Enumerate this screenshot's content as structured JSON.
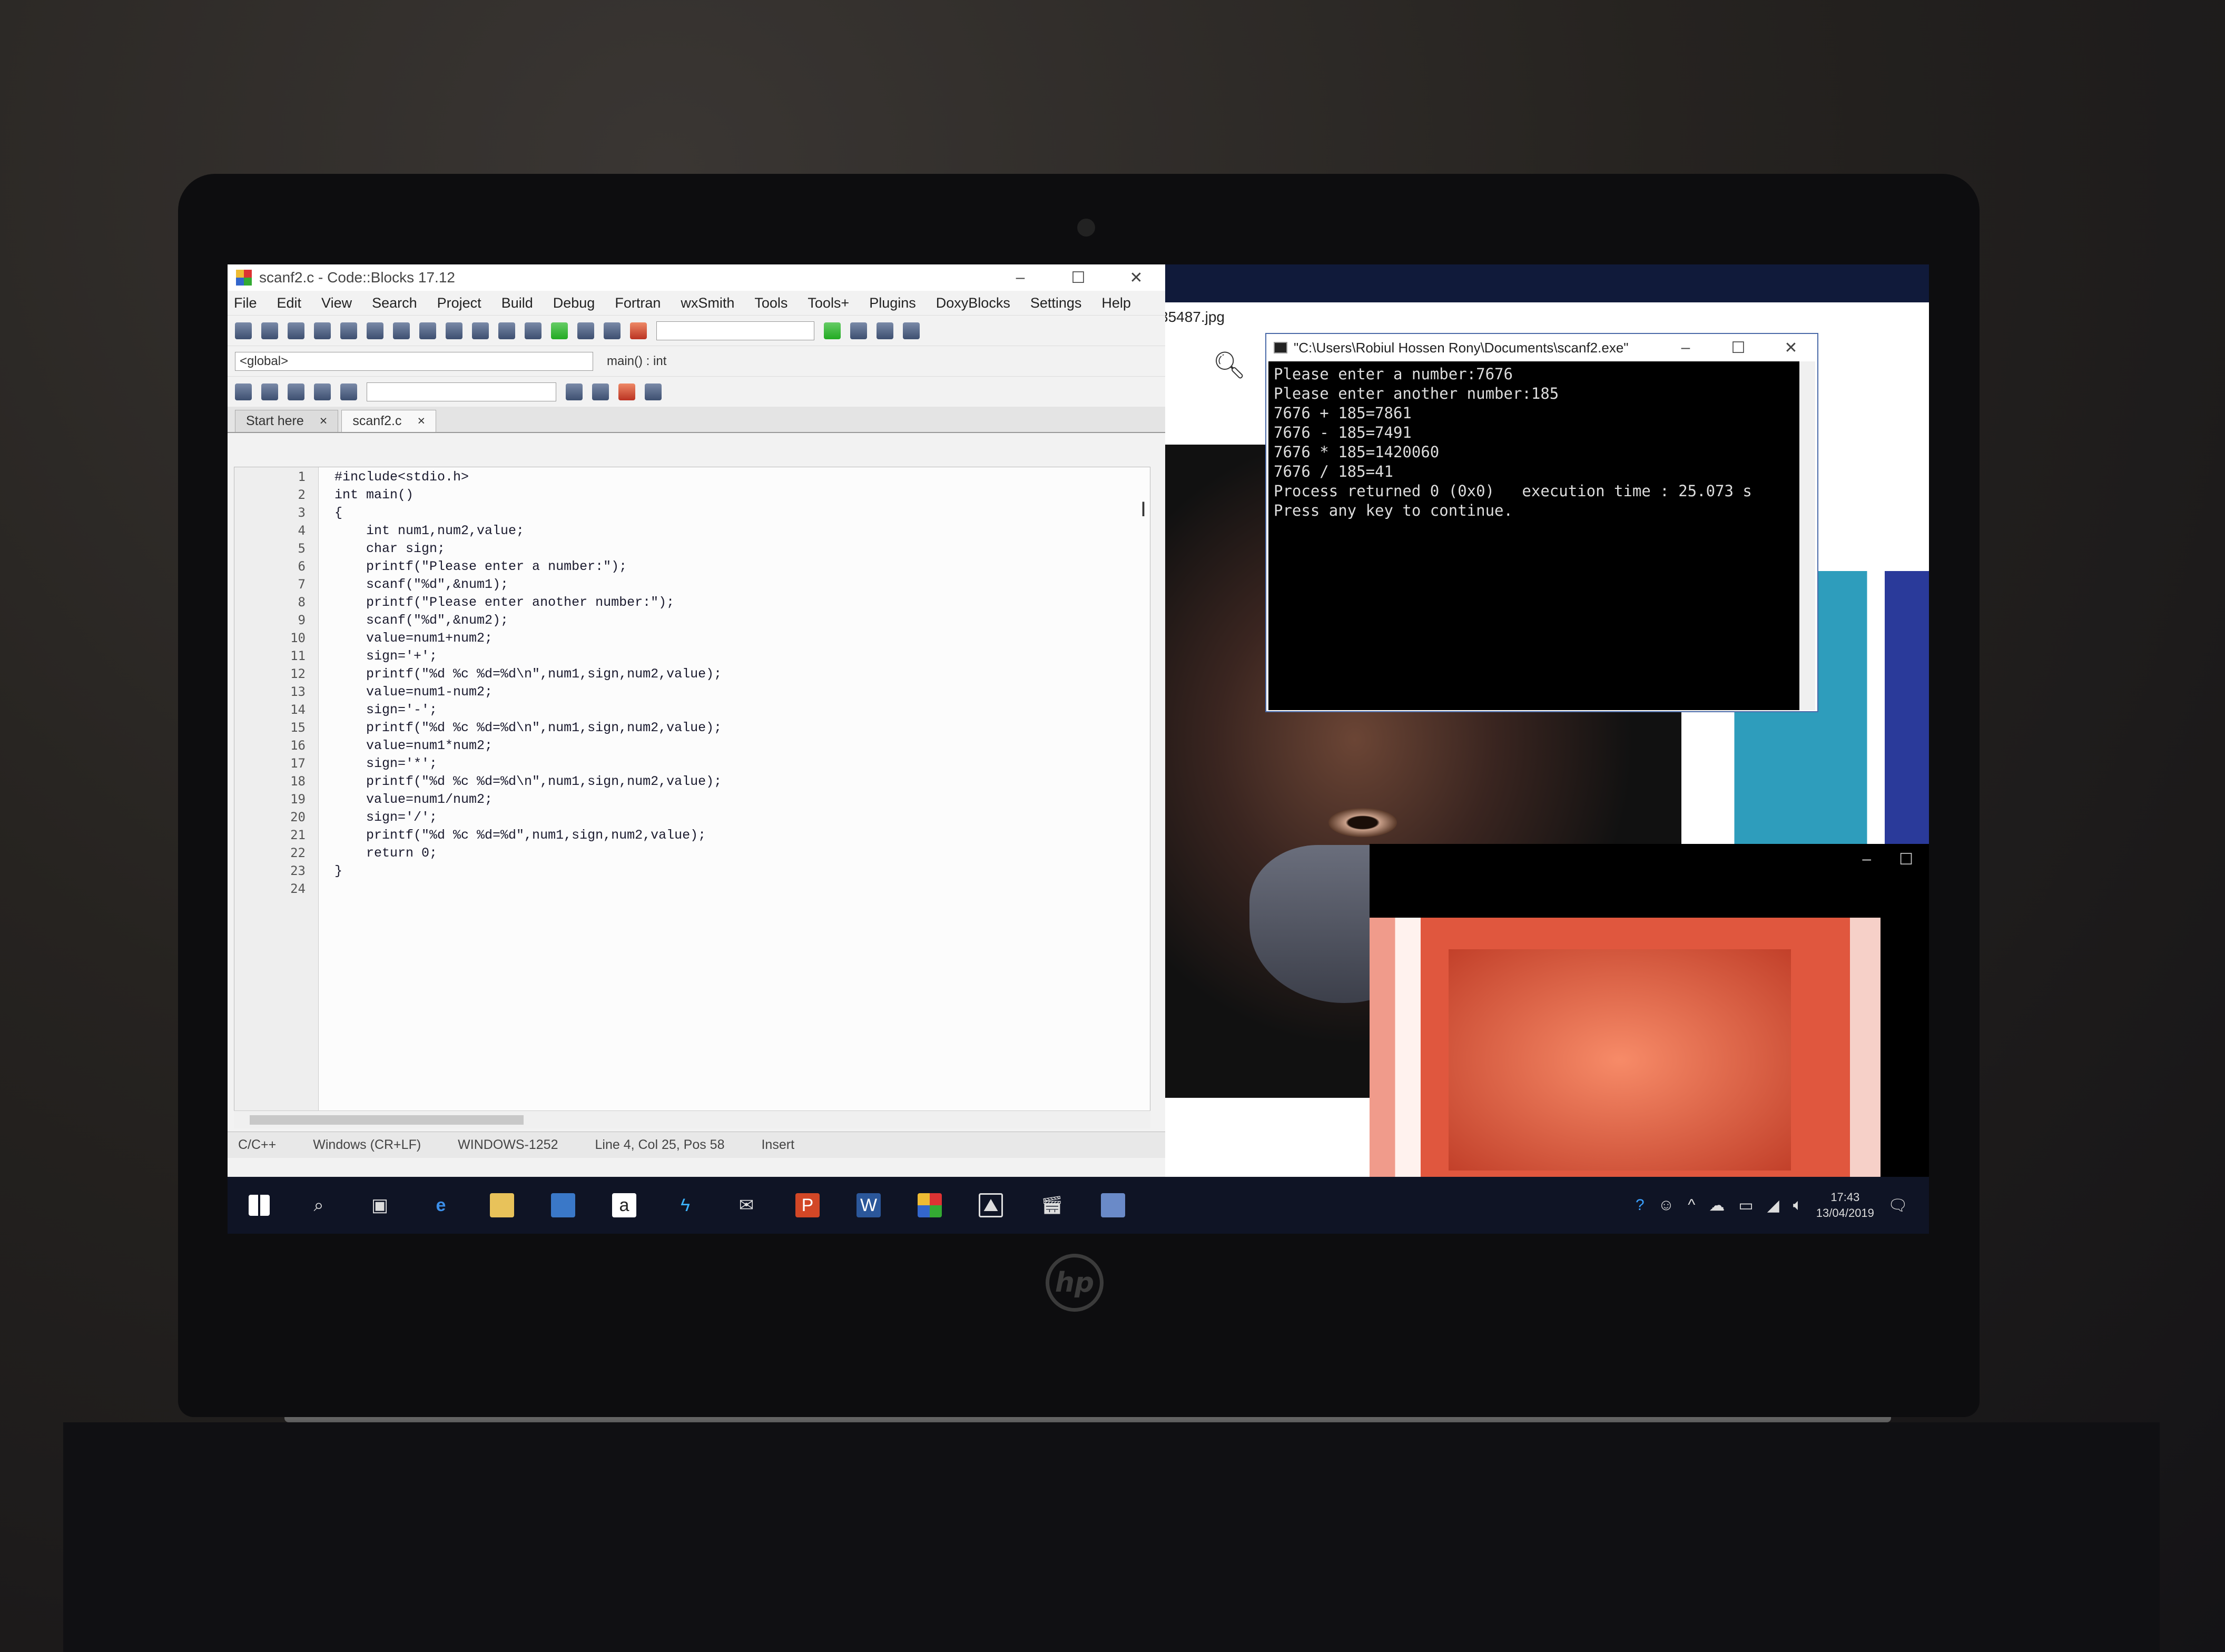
{
  "ide": {
    "title": "scanf2.c - Code::Blocks 17.12",
    "menu": [
      "File",
      "Edit",
      "View",
      "Search",
      "Project",
      "Build",
      "Debug",
      "Fortran",
      "wxSmith",
      "Tools",
      "Tools+",
      "Plugins",
      "DoxyBlocks",
      "Settings",
      "Help"
    ],
    "scope_combo": "<global>",
    "func_combo": "main() : int",
    "tabs": [
      {
        "label": "Start here",
        "close": "×"
      },
      {
        "label": "scanf2.c",
        "close": "×"
      }
    ],
    "code": [
      "#include<stdio.h>",
      "int main()",
      "{",
      "    int num1,num2,value;",
      "    char sign;",
      "    printf(\"Please enter a number:\");",
      "    scanf(\"%d\",&num1);",
      "    printf(\"Please enter another number:\");",
      "    scanf(\"%d\",&num2);",
      "    value=num1+num2;",
      "    sign='+';",
      "    printf(\"%d %c %d=%d\\n\",num1,sign,num2,value);",
      "    value=num1-num2;",
      "    sign='-';",
      "    printf(\"%d %c %d=%d\\n\",num1,sign,num2,value);",
      "    value=num1*num2;",
      "    sign='*';",
      "    printf(\"%d %c %d=%d\\n\",num1,sign,num2,value);",
      "    value=num1/num2;",
      "    sign='/';",
      "    printf(\"%d %c %d=%d\",num1,sign,num2,value);",
      "    return 0;",
      "}",
      ""
    ],
    "status": {
      "lang": "C/C++",
      "eol": "Windows (CR+LF)",
      "encoding": "WINDOWS-1252",
      "pos": "Line 4, Col 25, Pos 58",
      "mode": "Insert"
    }
  },
  "viewer": {
    "title": "35487.jpg"
  },
  "console": {
    "title": "\"C:\\Users\\Robiul Hossen Rony\\Documents\\scanf2.exe\"",
    "lines": [
      "Please enter a number:7676",
      "Please enter another number:185",
      "7676 + 185=7861",
      "7676 - 185=7491",
      "7676 * 185=1420060",
      "7676 / 185=41",
      "Process returned 0 (0x0)   execution time : 25.073 s",
      "Press any key to continue."
    ]
  },
  "taskbar": {
    "time": "17:43",
    "date": "13/04/2019"
  },
  "laptop": {
    "brand": "hp"
  }
}
